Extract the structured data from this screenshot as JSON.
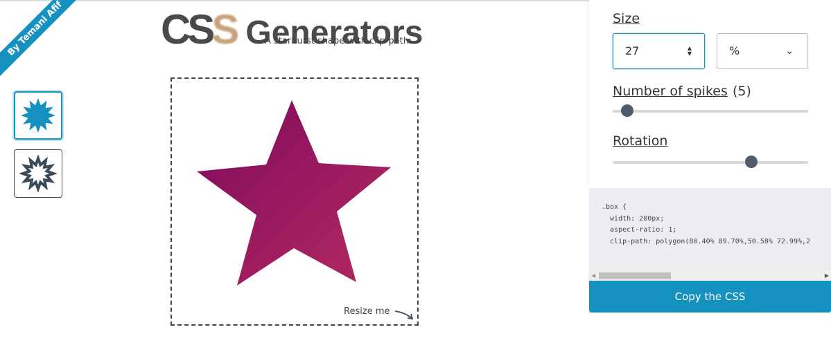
{
  "ribbon": {
    "text": "By Temani Afif"
  },
  "header": {
    "logo_css": "CS",
    "logo_s": "S",
    "logo_generators": "Generators",
    "subtitle": "A starburst shape with clip-path"
  },
  "shapes": [
    {
      "icon": "starburst-filled-icon",
      "active": true
    },
    {
      "icon": "starburst-outline-icon",
      "active": false
    }
  ],
  "preview": {
    "resize_label": "Resize me",
    "gradient": [
      "#7e0a5c",
      "#b52a61"
    ]
  },
  "controls": {
    "size_label": "Size",
    "size_value": "27",
    "unit_value": "%",
    "spikes_label": "Number of spikes",
    "spikes_count": "(5)",
    "spikes_value": 5,
    "spikes_fraction": 0.075,
    "rotation_label": "Rotation",
    "rotation_fraction": 0.71
  },
  "code": {
    "text": ".box {\n  width: 200px;\n  aspect-ratio: 1;\n  clip-path: polygon(80.40% 89.70%,50.58% 72.99%,2"
  },
  "copy_button": "Copy the CSS",
  "colors": {
    "accent": "#1591c0",
    "thumb": "#4e5d6c"
  }
}
